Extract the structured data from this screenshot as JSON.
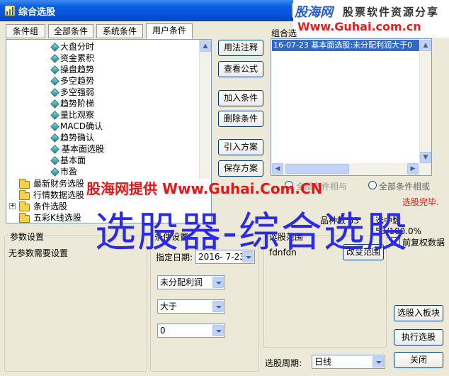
{
  "window": {
    "title": "综合选股",
    "brand_name": "股海网",
    "brand_slogan": "股票软件资源分享",
    "brand_url": "Www.Guhai.com.cn"
  },
  "tabs": [
    "条件组",
    "全部条件",
    "系统条件",
    "用户条件"
  ],
  "tree": {
    "leaf_items": [
      "大盘分时",
      "资金累积",
      "操盘趋势",
      "多空趋势",
      "多空强弱",
      "趋势阶梯",
      "量比观察",
      "MACD确认",
      "趋势确认",
      "基本面选股",
      "基本面",
      "市盈"
    ],
    "folders": [
      "最新财务选股",
      "行情数据选股",
      "条件选股",
      "五彩K线选股"
    ]
  },
  "side_buttons": [
    "用法注释",
    "查看公式",
    "加入条件",
    "删除条件",
    "引入方案",
    "保存方案"
  ],
  "combo_group": {
    "label": "组合选",
    "items": [
      "16-07-23 基本面选股:未分配利润大于0"
    ]
  },
  "radio": {
    "option1": "全部条件相与",
    "option2": "全部条件相或"
  },
  "status": {
    "done": "选股完毕.",
    "count": "品种数 53",
    "ratio": "选中数 53/100.0%",
    "prev_data_label": "前复权数据"
  },
  "params": {
    "label": "参数设置",
    "text": "无参数需要设置"
  },
  "condition": {
    "label": "条件设置",
    "date_label": "指定日期:",
    "date_value": "2016- 7-23",
    "field": "未分配利润",
    "operator": "大于",
    "value": "0"
  },
  "range": {
    "label": "选股范围",
    "value": "fdnfdn",
    "change_button": "改变范围"
  },
  "period": {
    "label": "选股周期:",
    "value": "日线"
  },
  "bottom_buttons": {
    "to_block": "选股入板块",
    "execute": "执行选股",
    "close": "关闭"
  },
  "watermark": {
    "red": "股海网提供 Www.Guhai.Com.CN",
    "blue": "选股器-综合选股"
  },
  "colors": {
    "titlebar": "#0553D8",
    "selected_item": "#316AC5",
    "status_red": "#E01818",
    "watermark_blue": "#2A2AE8"
  }
}
